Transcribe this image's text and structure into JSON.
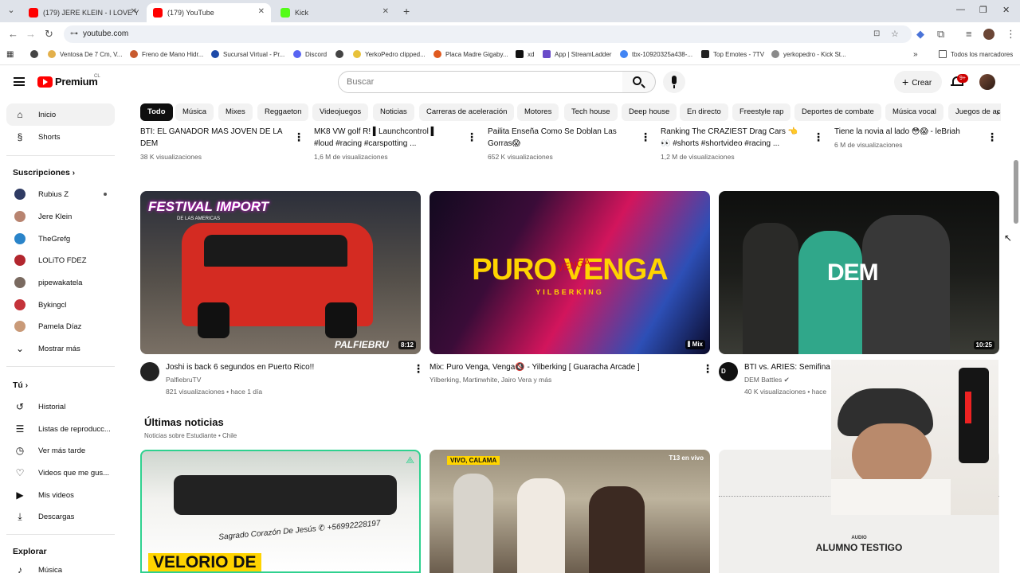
{
  "browser": {
    "tabs": [
      {
        "title": "(179) JERE KLEIN - I LOVE YOU |",
        "favicon_color": "#ff0000"
      },
      {
        "title": "(179) YouTube",
        "favicon_color": "#ff0000"
      },
      {
        "title": "Kick",
        "favicon_color": "#53fc18"
      }
    ],
    "url": "youtube.com",
    "bookmarks": [
      "Ventosa De 7 Cm, V...",
      "Freno de Mano Hidr...",
      "Sucursal Virtual - Pr...",
      "Discord",
      "YerkoPedro clipped...",
      "Placa Madre Gigaby...",
      "xd",
      "App | StreamLadder",
      "tbx-10920325a438-...",
      "Top Emotes - 7TV",
      "yerkopedro - Kick St..."
    ],
    "all_bookmarks": "Todos los marcadores"
  },
  "header": {
    "logo": "Premium",
    "country": "CL",
    "search_placeholder": "Buscar",
    "create": "Crear",
    "notifications": "9+"
  },
  "chips": [
    "Todo",
    "Música",
    "Mixes",
    "Reggaeton",
    "Videojuegos",
    "Noticias",
    "Carreras de aceleración",
    "Motores",
    "Tech house",
    "Deep house",
    "En directo",
    "Freestyle rap",
    "Deportes de combate",
    "Música vocal",
    "Juegos de ac"
  ],
  "sidebar": {
    "main": [
      "Inicio",
      "Shorts"
    ],
    "subs_title": "Suscripciones",
    "subs": [
      {
        "name": "Rubius Z",
        "color": "#2f3b63"
      },
      {
        "name": "Jere Klein",
        "color": "#b88470"
      },
      {
        "name": "TheGrefg",
        "color": "#2a84c9"
      },
      {
        "name": "LOLiTO FDEZ",
        "color": "#b2262e"
      },
      {
        "name": "pipewakatela",
        "color": "#7a6a60"
      },
      {
        "name": "Bykingcl",
        "color": "#c4333a"
      },
      {
        "name": "Pamela Díaz",
        "color": "#c99a78"
      }
    ],
    "show_more": "Mostrar más",
    "you_title": "Tú",
    "you": [
      "Historial",
      "Listas de reproducc...",
      "Ver más tarde",
      "Videos que me gus...",
      "Mis videos",
      "Descargas"
    ],
    "explore_title": "Explorar",
    "explore": [
      "Música"
    ]
  },
  "top_row": [
    {
      "title1": "BTI: EL GANADOR MAS JOVEN DE LA",
      "title2": "DEM",
      "meta": "38 K visualizaciones"
    },
    {
      "title1": "MK8 VW golf R! ▌Launchcontrol ▌",
      "title2": "#loud #racing #carspotting ...",
      "meta": "1,6 M de visualizaciones"
    },
    {
      "title1": "Pailita Enseña Como Se Doblan Las",
      "title2": "Gorras😱",
      "meta": "652 K visualizaciones"
    },
    {
      "title1": "Ranking The CRAZIEST Drag Cars 👈",
      "title2": "👀 #shorts #shortvideo #racing ...",
      "meta": "1,2 M de visualizaciones"
    },
    {
      "title1": "Tiene la novia al lado 😳😱 - leBriah",
      "title2": "",
      "meta": "6 M de visualizaciones"
    }
  ],
  "videos": [
    {
      "title": "Joshi is back 6 segundos en Puerto Rico!!",
      "channel": "PalfiebruTV",
      "stats": "821 visualizaciones • hace 1 día",
      "duration": "8:12",
      "thumb_text": "FESTIVAL IMPORT",
      "thumb_sub": "DE LAS AMERICAS",
      "thumb_brand": "PALFIEBRU"
    },
    {
      "title": "Mix: Puro Venga, Venga🔇 - Yilberking [ Guaracha Arcade ]",
      "channel": "Yilberking, Martinwhite, Jairo Vera y más",
      "stats": "",
      "duration": "Mix",
      "thumb_text": "PURO VENGA",
      "thumb_sub": "YILBERKING",
      "thumb_brand": "VENGA"
    },
    {
      "title": "BTI vs. ARIES: Semifina",
      "channel": "DEM Battles",
      "stats": "40 K visualizaciones • hace",
      "duration": "10:25",
      "thumb_text": "DEM"
    }
  ],
  "news": {
    "title": "Últimas noticias",
    "subtitle": "Noticias sobre Estudiante • Chile",
    "cards": [
      {
        "overlay": "VELORIO DE",
        "banner": "Sagrado Corazón De Jesús ✆ +56992228197"
      },
      {
        "tag": "VIVO, CALAMA",
        "corner": "T13 en vivo"
      },
      {
        "tag": "AUDIO",
        "overlay": "ALUMNO TESTIGO"
      }
    ]
  }
}
